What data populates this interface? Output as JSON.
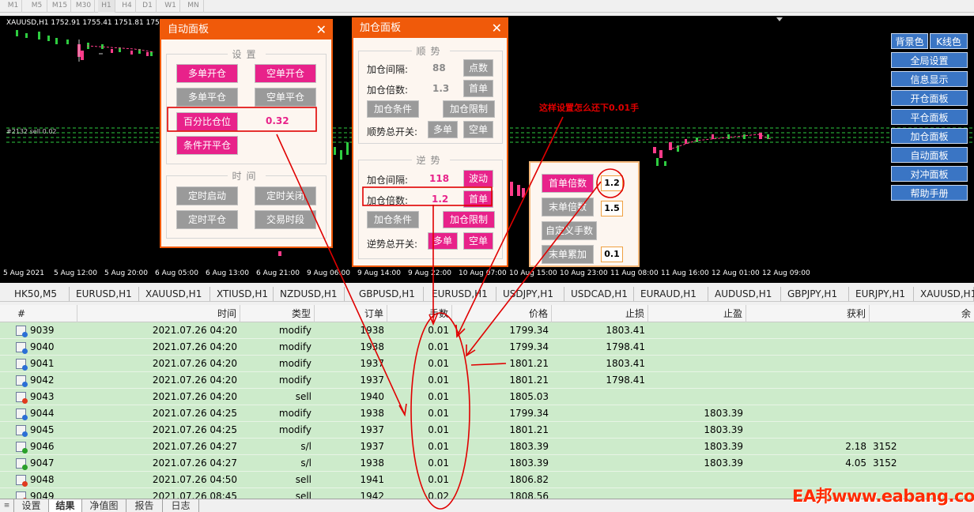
{
  "timeframes": [
    "M1",
    "M5",
    "M15",
    "M30",
    "H1",
    "H4",
    "D1",
    "W1",
    "MN"
  ],
  "chart": {
    "info": "XAUUSD,H1  1752.91 1755.41 1751.81 1755.41",
    "order_label": "#2132 sell 0.02",
    "dates": [
      "5 Aug 2021",
      "5 Aug 12:00",
      "5 Aug 20:00",
      "6 Aug 05:00",
      "6 Aug 13:00",
      "6 Aug 21:00",
      "9 Aug 06:00",
      "9 Aug 14:00",
      "9 Aug 22:00",
      "10 Aug 07:00",
      "10 Aug 15:00",
      "10 Aug 23:00",
      "11 Aug 08:00",
      "11 Aug 16:00",
      "12 Aug 01:00",
      "12 Aug 09:00"
    ]
  },
  "right_panel": {
    "bg_label": "背景色",
    "kline_label": "K线色",
    "items": [
      "全局设置",
      "信息显示",
      "开仓面板",
      "平仓面板",
      "加仓面板",
      "自动面板",
      "对冲面板",
      "帮助手册"
    ]
  },
  "auto_panel": {
    "title": "自动面板",
    "close": "✕",
    "settings_group": "设置",
    "buy_open": "多单开仓",
    "sell_open": "空单开仓",
    "buy_close": "多单平仓",
    "sell_close": "空单平仓",
    "pct_position": "百分比仓位",
    "pct_value": "0.32",
    "cond_open_close": "条件开平仓",
    "time_group": "时间",
    "timer_start": "定时启动",
    "timer_stop": "定时关闭",
    "timer_close": "定时平仓",
    "trade_session": "交易时段"
  },
  "add_panel": {
    "title": "加仓面板",
    "close": "✕",
    "trend_group": "顺势",
    "interval_label": "加仓间隔:",
    "trend_interval": "88",
    "points_btn": "点数",
    "multiplier_label": "加仓倍数:",
    "trend_mult": "1.3",
    "first_btn": "首单",
    "add_condition": "加仓条件",
    "add_limit": "加仓限制",
    "trend_switch_label": "顺势总开关:",
    "buy_btn": "多单",
    "sell_btn": "空单",
    "counter_group": "逆势",
    "counter_interval": "118",
    "wave_btn": "波动",
    "counter_mult": "1.2",
    "counter_switch_label": "逆势总开关:"
  },
  "lot_panel": {
    "first_mult": "首单倍数",
    "first_value": "1.2",
    "last_mult": "末单倍数",
    "last_value": "1.5",
    "custom_lots": "自定义手数",
    "last_add": "末单累加",
    "add_value": "0.1"
  },
  "annotation": "这样设置怎么还下0.01手",
  "symbol_tabs": [
    "HK50,M5",
    "EURUSD,H1",
    "XAUUSD,H1",
    "XTIUSD,H1",
    "NZDUSD,H1",
    "GBPUSD,H1",
    "EURUSD,H1",
    "USDJPY,H1",
    "USDCAD,H1",
    "EURAUD,H1",
    "AUDUSD,H1",
    "GBPJPY,H1",
    "EURJPY,H1",
    "XAUUSD,H1"
  ],
  "table": {
    "headers": [
      "#",
      "时间",
      "类型",
      "订单",
      "手数",
      "价格",
      "止损",
      "止盈",
      "获利",
      "余"
    ],
    "rows": [
      {
        "id": "9039",
        "time": "2021.07.26 04:20",
        "type": "modify",
        "order": "1938",
        "lots": "0.01",
        "price": "1799.34",
        "sl": "1803.41",
        "tp": "",
        "profit": "",
        "bal": "",
        "icon": "blue"
      },
      {
        "id": "9040",
        "time": "2021.07.26 04:20",
        "type": "modify",
        "order": "1938",
        "lots": "0.01",
        "price": "1799.34",
        "sl": "1798.41",
        "tp": "",
        "profit": "",
        "bal": "",
        "icon": "blue"
      },
      {
        "id": "9041",
        "time": "2021.07.26 04:20",
        "type": "modify",
        "order": "1937",
        "lots": "0.01",
        "price": "1801.21",
        "sl": "1803.41",
        "tp": "",
        "profit": "",
        "bal": "",
        "icon": "blue"
      },
      {
        "id": "9042",
        "time": "2021.07.26 04:20",
        "type": "modify",
        "order": "1937",
        "lots": "0.01",
        "price": "1801.21",
        "sl": "1798.41",
        "tp": "",
        "profit": "",
        "bal": "",
        "icon": "blue"
      },
      {
        "id": "9043",
        "time": "2021.07.26 04:20",
        "type": "sell",
        "order": "1940",
        "lots": "0.01",
        "price": "1805.03",
        "sl": "",
        "tp": "",
        "profit": "",
        "bal": "",
        "icon": "red"
      },
      {
        "id": "9044",
        "time": "2021.07.26 04:25",
        "type": "modify",
        "order": "1938",
        "lots": "0.01",
        "price": "1799.34",
        "sl": "",
        "tp": "1803.39",
        "profit": "",
        "bal": "",
        "icon": "blue"
      },
      {
        "id": "9045",
        "time": "2021.07.26 04:25",
        "type": "modify",
        "order": "1937",
        "lots": "0.01",
        "price": "1801.21",
        "sl": "",
        "tp": "1803.39",
        "profit": "",
        "bal": "",
        "icon": "blue"
      },
      {
        "id": "9046",
        "time": "2021.07.26 04:27",
        "type": "s/l",
        "order": "1937",
        "lots": "0.01",
        "price": "1803.39",
        "sl": "",
        "tp": "1803.39",
        "profit": "2.18",
        "bal": "3152",
        "icon": "green"
      },
      {
        "id": "9047",
        "time": "2021.07.26 04:27",
        "type": "s/l",
        "order": "1938",
        "lots": "0.01",
        "price": "1803.39",
        "sl": "",
        "tp": "1803.39",
        "profit": "4.05",
        "bal": "3152",
        "icon": "green"
      },
      {
        "id": "9048",
        "time": "2021.07.26 04:50",
        "type": "sell",
        "order": "1941",
        "lots": "0.01",
        "price": "1806.82",
        "sl": "",
        "tp": "",
        "profit": "",
        "bal": "",
        "icon": "red"
      },
      {
        "id": "9049",
        "time": "2021.07.26 08:45",
        "type": "sell",
        "order": "1942",
        "lots": "0.02",
        "price": "1808.56",
        "sl": "",
        "tp": "",
        "profit": "",
        "bal": "",
        "icon": "red"
      }
    ]
  },
  "bottom_tabs": [
    "设置",
    "结果",
    "净值图",
    "报告",
    "日志"
  ],
  "watermark": "EA邦www.eabang.com",
  "colors": {
    "accent": "#f05a0a",
    "pink": "#e8228a",
    "blue_btn": "#3a75c4",
    "row_green": "#cdebcb",
    "annotation": "#e00000"
  }
}
